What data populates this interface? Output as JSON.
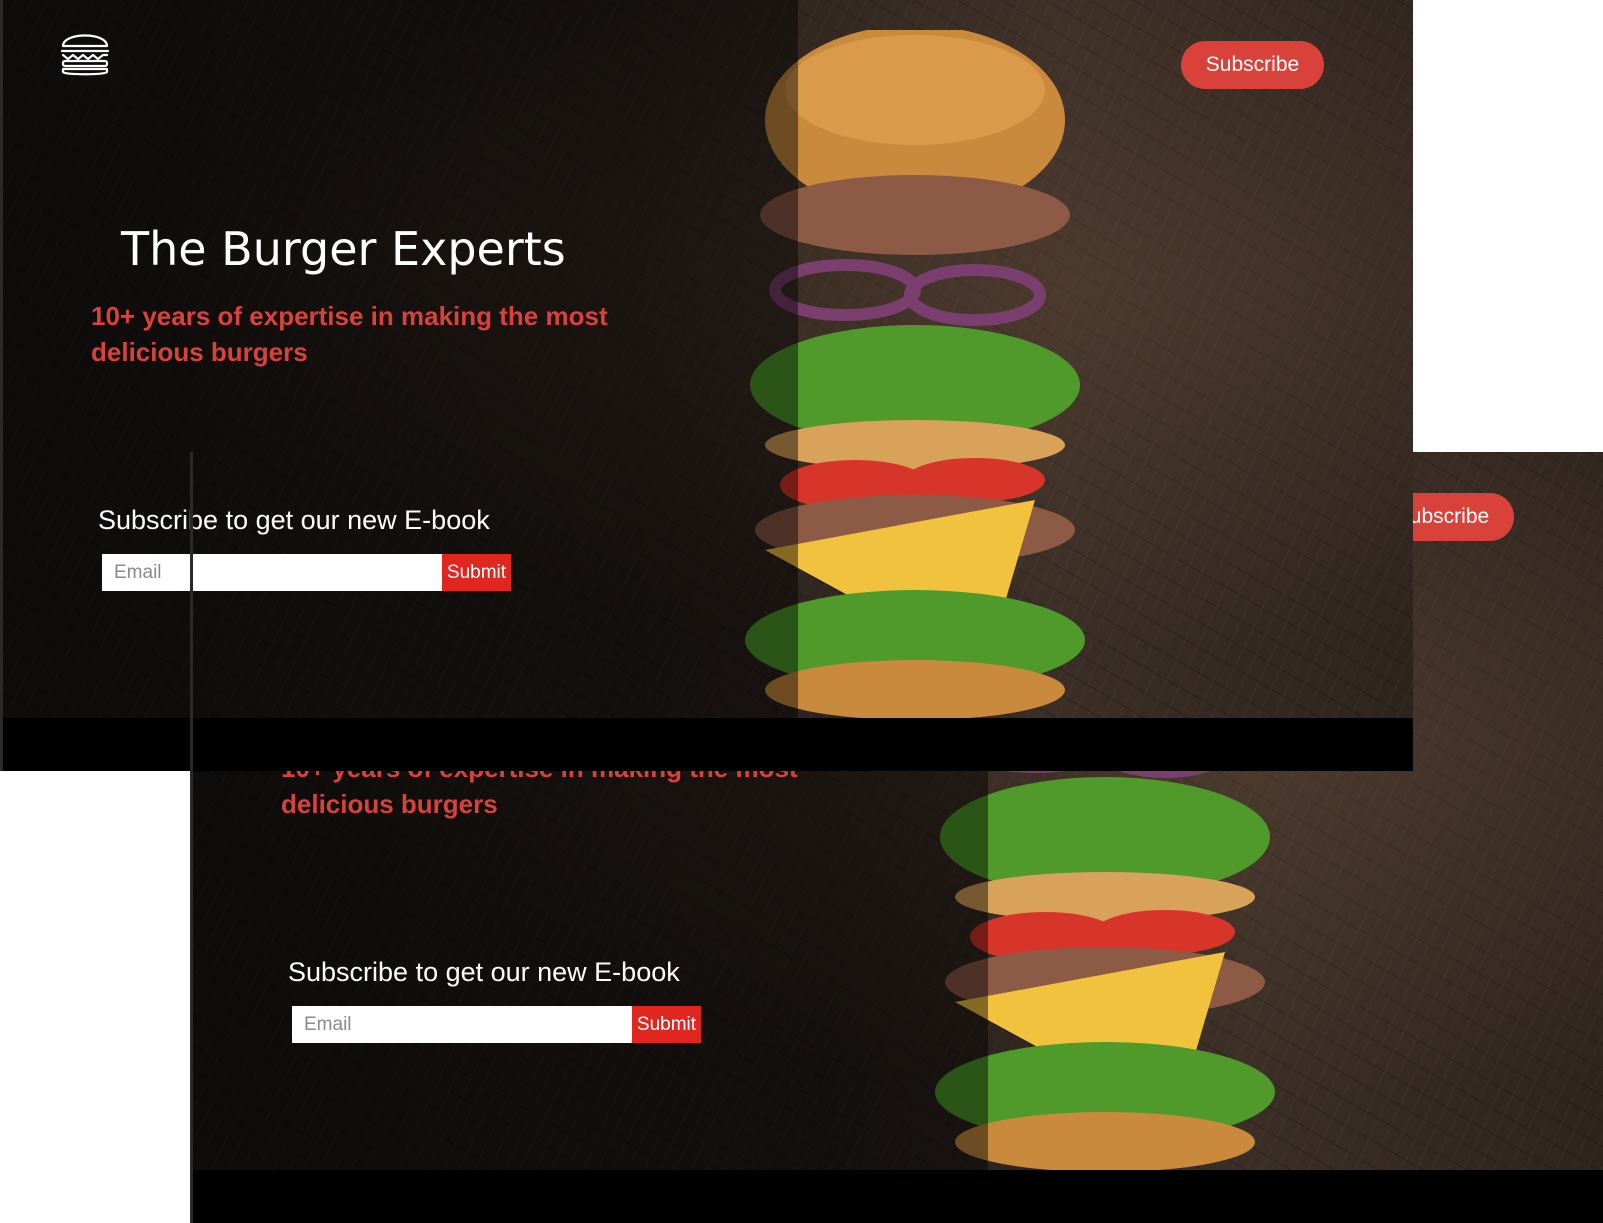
{
  "page": {
    "subscribe_button": "Subscribe",
    "title": "The Burger Experts",
    "tagline": "10+ years of expertise in making the most delicious burgers",
    "ebook_heading": "Subscribe to get our new E-book",
    "email_placeholder": "Email",
    "submit_label": "Submit"
  },
  "colors": {
    "accent": "#d9423b",
    "submit": "#e0261f",
    "background": "#000000"
  },
  "icons": {
    "logo": "burger-logo-icon",
    "hero_image": "floating-burger-image"
  }
}
